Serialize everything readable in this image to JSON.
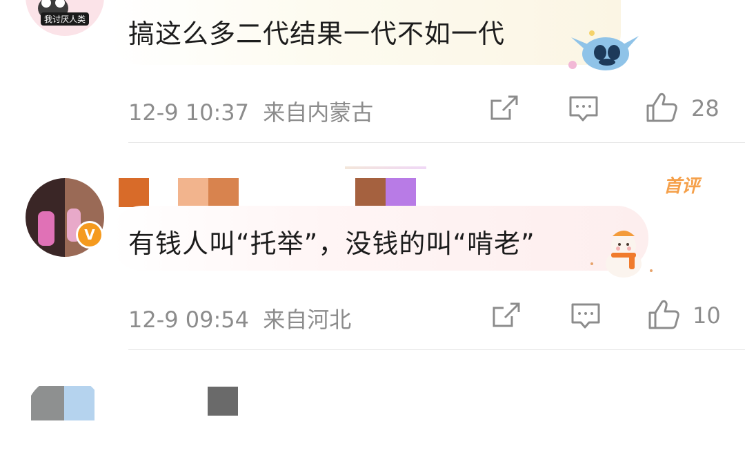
{
  "comments": [
    {
      "avatar_text": "我讨厌人类",
      "text": "搞这么多二代结果一代不如一代",
      "time": "12-9 10:37",
      "location": "来自内蒙古",
      "likes": "28",
      "sticker": "stitch-sticker"
    },
    {
      "avatar_badge": "V",
      "top_badge": "首评",
      "text": "有钱人叫“托举”，没钱的叫“啃老”",
      "time": "12-9 09:54",
      "location": "来自河北",
      "likes": "10",
      "sticker": "snowman-sticker"
    }
  ],
  "icons": {
    "share": "share-icon",
    "reply": "comment-icon",
    "like": "thumbs-up-icon"
  },
  "colors": {
    "meta_text": "#8c8c8c",
    "vip_badge": "#f59a1e",
    "top_badge": "#f5a04a"
  }
}
